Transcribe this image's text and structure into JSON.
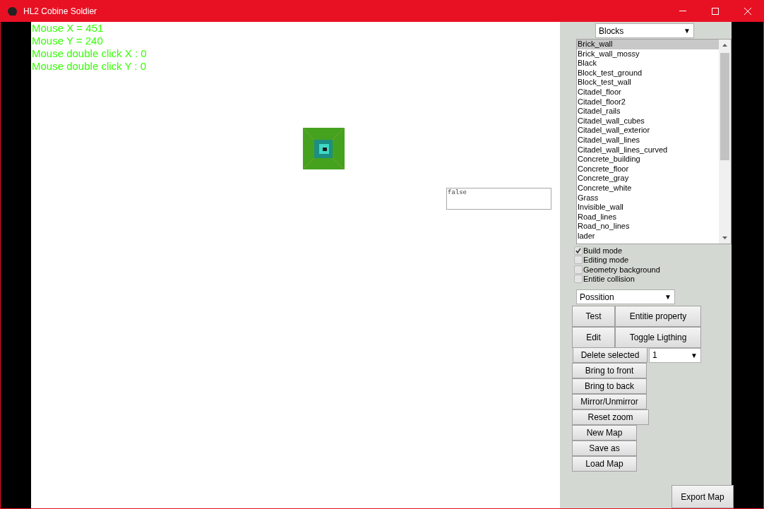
{
  "window": {
    "title": "HL2 Cobine Soldier"
  },
  "readouts": [
    "Mouse X = 451",
    "Mouse Y = 240",
    "Mouse double click X : 0",
    "Mouse double click Y : 0"
  ],
  "text_field": {
    "value": "false"
  },
  "category_select": {
    "value": "Blocks",
    "arrow": "▼"
  },
  "block_list": [
    {
      "label": "Brick_wall",
      "selected": true
    },
    {
      "label": "Brick_wall_mossy",
      "selected": false
    },
    {
      "label": "Black",
      "selected": false
    },
    {
      "label": "Block_test_ground",
      "selected": false
    },
    {
      "label": "Block_test_wall",
      "selected": false
    },
    {
      "label": "Citadel_floor",
      "selected": false
    },
    {
      "label": "Citadel_floor2",
      "selected": false
    },
    {
      "label": "Citadel_rails",
      "selected": false
    },
    {
      "label": "Citadel_wall_cubes",
      "selected": false
    },
    {
      "label": "Citadel_wall_exterior",
      "selected": false
    },
    {
      "label": "Citadel_wall_lines",
      "selected": false
    },
    {
      "label": "Citadel_wall_lines_curved",
      "selected": false
    },
    {
      "label": "Concrete_building",
      "selected": false
    },
    {
      "label": "Concrete_floor",
      "selected": false
    },
    {
      "label": "Concrete_gray",
      "selected": false
    },
    {
      "label": "Concrete_white",
      "selected": false
    },
    {
      "label": "Grass",
      "selected": false
    },
    {
      "label": "Invisible_wall",
      "selected": false
    },
    {
      "label": "Road_lines",
      "selected": false
    },
    {
      "label": "Road_no_lines",
      "selected": false
    },
    {
      "label": "lader",
      "selected": false
    }
  ],
  "checkboxes": [
    {
      "label": "Build mode",
      "checked": true
    },
    {
      "label": "Editing mode",
      "checked": false
    },
    {
      "label": "Geometry background",
      "checked": false
    },
    {
      "label": "Entitie collision",
      "checked": false
    }
  ],
  "mode_select": {
    "value": "Possition",
    "arrow": "▼"
  },
  "grid_buttons": [
    [
      "Test",
      "Entitie property"
    ],
    [
      "Edit",
      "Toggle Ligthing"
    ]
  ],
  "delete_button": "Delete selected",
  "amount_select": {
    "value": "1",
    "arrow": "▼"
  },
  "buttons": [
    "Bring to front",
    "Bring to back",
    "Mirror/Unmirror",
    "Reset zoom",
    "New Map",
    "Save as",
    "Load Map"
  ],
  "export_button": "Export Map"
}
